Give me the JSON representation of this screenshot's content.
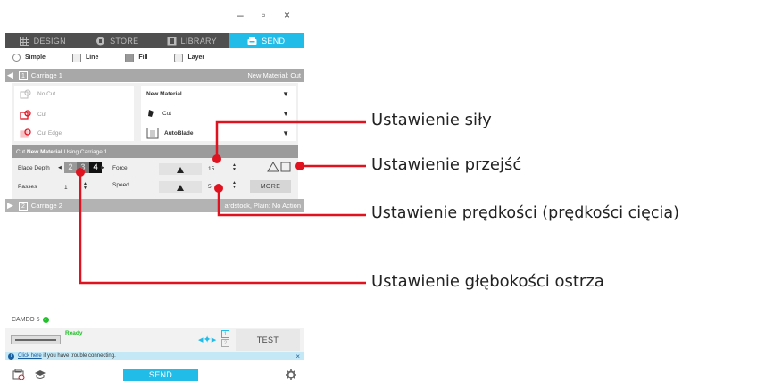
{
  "window_controls": {
    "minimize": "–",
    "maximize": "▫",
    "close": "×"
  },
  "tabs": [
    {
      "label": "DESIGN",
      "icon": "grid-icon"
    },
    {
      "label": "STORE",
      "icon": "store-icon"
    },
    {
      "label": "LIBRARY",
      "icon": "library-icon"
    },
    {
      "label": "SEND",
      "icon": "send-icon"
    }
  ],
  "modes": [
    {
      "label": "Simple",
      "icon": "radio-icon"
    },
    {
      "label": "Line",
      "icon": "line-icon"
    },
    {
      "label": "Fill",
      "icon": "fill-icon"
    },
    {
      "label": "Layer",
      "icon": "layer-icon"
    }
  ],
  "carriage1": {
    "num": "1",
    "label": "Carriage 1",
    "material_right": "New Material: Cut"
  },
  "cut_options": [
    {
      "label": "No Cut"
    },
    {
      "label": "Cut"
    },
    {
      "label": "Cut Edge"
    }
  ],
  "selects": {
    "material": "New Material",
    "action": "Cut",
    "tool": "AutoBlade"
  },
  "subbar": {
    "prefix": "Cut ",
    "material": "New Material",
    "suffix": " Using Carriage 1"
  },
  "settings": {
    "blade_depth_label": "Blade Depth",
    "blade_values": [
      "2",
      "3",
      "4"
    ],
    "force_label": "Force",
    "force_value": "15",
    "passes_label": "Passes",
    "passes_value": "1",
    "speed_label": "Speed",
    "speed_value": "5",
    "more_label": "MORE"
  },
  "carriage2": {
    "num": "2",
    "label": "Carriage 2",
    "material_right": "ardstock, Plain: No Action"
  },
  "status": {
    "device": "CAMEO 5",
    "ready": "Ready",
    "port1": "1",
    "port2": "2",
    "test_label": "TEST"
  },
  "info": {
    "link": "Click here",
    "text": " if you have trouble connecting.",
    "close": "×"
  },
  "bottom": {
    "send_label": "SEND"
  },
  "annotations": {
    "force": "Ustawienie siły",
    "passes": "Ustawienie przejść",
    "speed": "Ustawienie prędkości (prędkości cięcia)",
    "blade": "Ustawienie głębokości ostrza"
  },
  "colors": {
    "accent": "#21bde8",
    "annotation": "#e0121f",
    "ready": "#22c02a"
  }
}
